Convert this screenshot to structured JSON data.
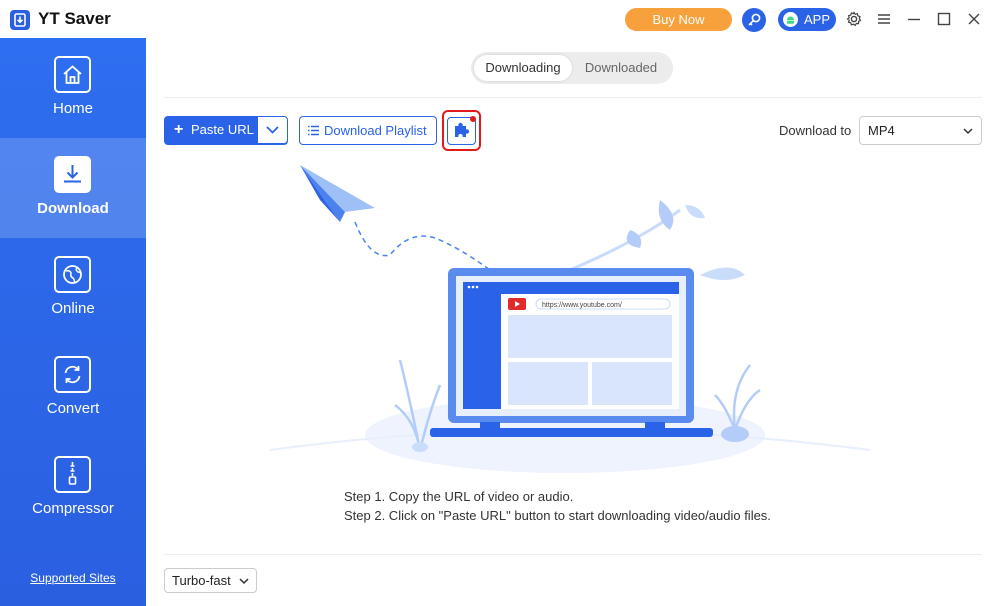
{
  "app": {
    "title": "YT Saver"
  },
  "titlebar": {
    "buy_now": "Buy Now",
    "app_label": "APP",
    "icons": [
      "key-icon",
      "android-icon",
      "gear-icon",
      "menu-icon",
      "minimize-icon",
      "maximize-icon",
      "close-icon"
    ]
  },
  "sidebar": {
    "items": [
      {
        "label": "Home",
        "icon": "home-icon"
      },
      {
        "label": "Download",
        "icon": "download-icon",
        "active": true
      },
      {
        "label": "Online",
        "icon": "globe-icon"
      },
      {
        "label": "Convert",
        "icon": "convert-icon"
      },
      {
        "label": "Compressor",
        "icon": "zip-icon"
      }
    ],
    "supported_sites": "Supported Sites"
  },
  "tabs": [
    {
      "label": "Downloading",
      "active": true
    },
    {
      "label": "Downloaded"
    }
  ],
  "toolbar": {
    "paste_url": "Paste URL",
    "download_playlist": "Download Playlist",
    "download_to_label": "Download to",
    "format_value": "MP4"
  },
  "illustration": {
    "url_text": "https://www.youtube.com/"
  },
  "steps": {
    "step1": "Step 1. Copy the URL of video or audio.",
    "step2": "Step 2. Click on \"Paste URL\" button to start downloading video/audio files."
  },
  "footer": {
    "speed_value": "Turbo-fast"
  },
  "colors": {
    "accent": "#2a62e8",
    "buy_now": "#f7a13c",
    "highlight": "#e01b1b"
  }
}
